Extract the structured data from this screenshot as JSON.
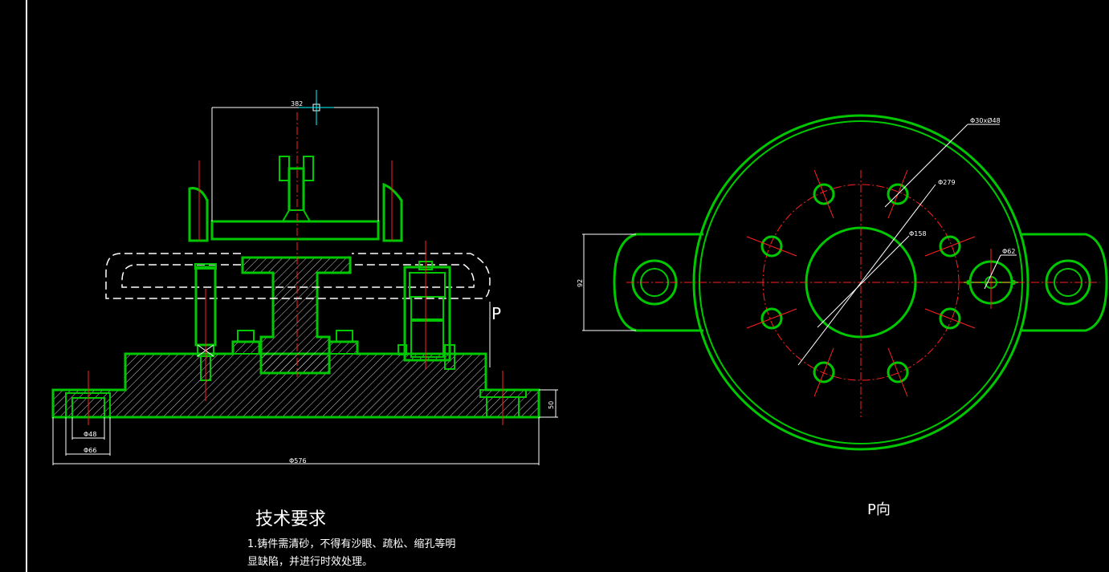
{
  "dimensions": {
    "top_width": "382",
    "d48": "Φ48",
    "d66": "Φ66",
    "base_dia": "Φ576",
    "base_h": "50",
    "left_h": "92",
    "bolt_circle": "Φ30xØ48",
    "pcd": "Φ279",
    "hub": "Φ158",
    "hole": "Φ62"
  },
  "labels": {
    "view_arrow": "P",
    "view_title": "P向"
  },
  "tech": {
    "title": "技术要求",
    "line1": "1.铸件需清砂，不得有沙眼、疏松、缩孔等明",
    "line2": "显缺陷，并进行时效处理。"
  },
  "colors": {
    "background": "#000000",
    "outline": "#00c800",
    "centerline": "#ff2020",
    "dimension": "#ffffff"
  }
}
